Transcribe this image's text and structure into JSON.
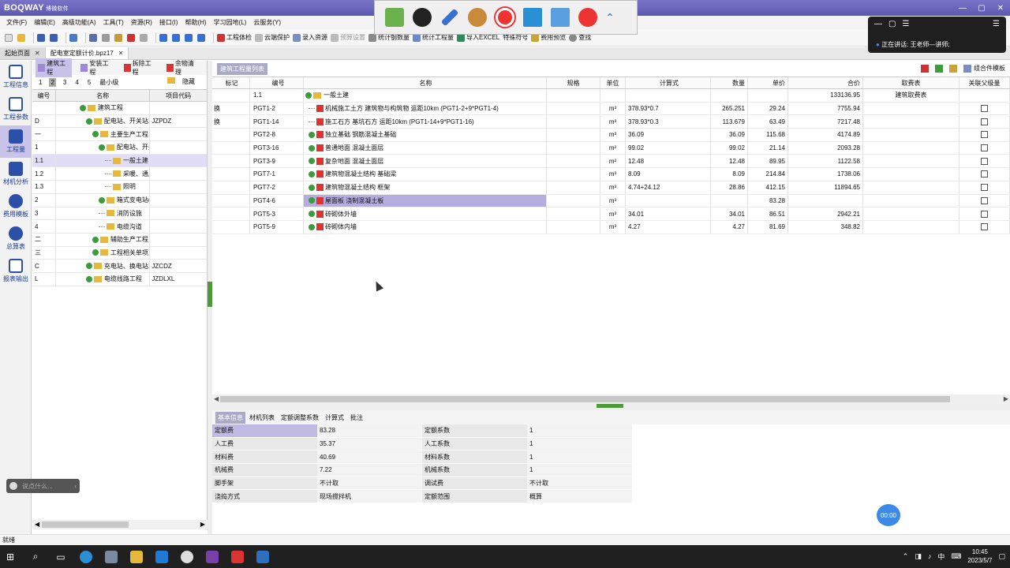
{
  "app": {
    "logo": "BOQWAY",
    "logo_sub": "博微软件"
  },
  "menu": [
    "文件(F)",
    "编辑(E)",
    "高级功能(A)",
    "工具(T)",
    "资源(R)",
    "接口(I)",
    "帮助(H)",
    "学习园地(L)",
    "云服务(Y)"
  ],
  "toolbar": [
    "工程体检",
    "云端保护",
    "录入资源",
    "预算设置",
    "统计钢数量",
    "统计工程量",
    "导入EXCEL",
    "特殊符号",
    "费用预览",
    "查找"
  ],
  "doc_tabs": [
    {
      "label": "起始页面"
    },
    {
      "label": "配电室定额计价.bpz17"
    }
  ],
  "leftbar": [
    "工程信息",
    "工程参数",
    "工程量",
    "材机分析",
    "费用模板",
    "总算表",
    "报表输出"
  ],
  "left_panel": {
    "tabs": [
      "建筑工程",
      "安装工程",
      "拆除工程",
      "余物清理"
    ],
    "levels": [
      "1",
      "2",
      "3",
      "4",
      "5",
      "最小级"
    ],
    "hide": "隐藏",
    "headers": [
      "编号",
      "名称",
      "项目代码"
    ],
    "rows": [
      {
        "code": "",
        "name": "建筑工程",
        "pc": ""
      },
      {
        "code": "D",
        "name": "配电站、开关站工程",
        "pc": "JZPDZ"
      },
      {
        "code": "一",
        "name": "主要生产工程",
        "pc": ""
      },
      {
        "code": "1",
        "name": "配电站、开关站",
        "pc": ""
      },
      {
        "code": "1.1",
        "name": "一般土建",
        "pc": ""
      },
      {
        "code": "1.2",
        "name": "采暖、通风及空调",
        "pc": ""
      },
      {
        "code": "1.3",
        "name": "照明",
        "pc": ""
      },
      {
        "code": "2",
        "name": "箱式变电站(环网箱)",
        "pc": ""
      },
      {
        "code": "3",
        "name": "消防设施",
        "pc": ""
      },
      {
        "code": "4",
        "name": "电缆沟道",
        "pc": ""
      },
      {
        "code": "二",
        "name": "辅助生产工程",
        "pc": ""
      },
      {
        "code": "三",
        "name": "工程相关单项工程",
        "pc": ""
      },
      {
        "code": "C",
        "name": "充电站、换电站工程",
        "pc": "JZCDZ"
      },
      {
        "code": "L",
        "name": "电缆线路工程",
        "pc": "JZDLXL"
      }
    ]
  },
  "grid": {
    "tab": "建筑工程量列表",
    "right_label": "组合件模板",
    "headers": [
      "标记",
      "编号",
      "名称",
      "规格",
      "单位",
      "计算式",
      "数量",
      "单价",
      "合价",
      "取费表",
      "关联父级量"
    ],
    "rows": [
      {
        "mark": "",
        "code": "1.1",
        "name": "一般土建",
        "spec": "",
        "unit": "",
        "formula": "",
        "qty": "",
        "price": "",
        "total": "133136.95",
        "table": "建筑取费表"
      },
      {
        "mark": "换",
        "code": "PGT1-2",
        "name": "机械施工土方 建筑物与构筑物 运距10km (PGT1-2+9*PGT1-4)",
        "spec": "",
        "unit": "m³",
        "formula": "378.93*0.7",
        "qty": "265.251",
        "price": "29.24",
        "total": "7755.94",
        "table": ""
      },
      {
        "mark": "换",
        "code": "PGT1-14",
        "name": "施工石方 基坑石方 运距10km (PGT1-14+9*PGT1-16)",
        "spec": "",
        "unit": "m³",
        "formula": "378.93*0.3",
        "qty": "113.679",
        "price": "63.49",
        "total": "7217.48",
        "table": ""
      },
      {
        "mark": "",
        "code": "PGT2-8",
        "name": "独立基础 钢筋混凝土基础",
        "spec": "",
        "unit": "m³",
        "formula": "36.09",
        "qty": "36.09",
        "price": "115.68",
        "total": "4174.89",
        "table": ""
      },
      {
        "mark": "",
        "code": "PGT3-16",
        "name": "普通地面 混凝土面层",
        "spec": "",
        "unit": "m²",
        "formula": "99.02",
        "qty": "99.02",
        "price": "21.14",
        "total": "2093.28",
        "table": ""
      },
      {
        "mark": "",
        "code": "PGT3-9",
        "name": "复杂地面 混凝土面层",
        "spec": "",
        "unit": "m²",
        "formula": "12.48",
        "qty": "12.48",
        "price": "89.95",
        "total": "1122.58",
        "table": ""
      },
      {
        "mark": "",
        "code": "PGT7-1",
        "name": "建筑物混凝土结构 基础梁",
        "spec": "",
        "unit": "m³",
        "formula": "8.09",
        "qty": "8.09",
        "price": "214.84",
        "total": "1738.06",
        "table": ""
      },
      {
        "mark": "",
        "code": "PGT7-2",
        "name": "建筑物混凝土结构 框架",
        "spec": "",
        "unit": "m³",
        "formula": "4.74+24.12",
        "qty": "28.86",
        "price": "412.15",
        "total": "11894.65",
        "table": ""
      },
      {
        "mark": "",
        "code": "PGT4-6",
        "name": "屋面板 浇制混凝土板",
        "spec": "",
        "unit": "m³",
        "formula": "",
        "qty": "",
        "price": "83.28",
        "total": "",
        "table": ""
      },
      {
        "mark": "",
        "code": "PGT5-3",
        "name": "砖砌体外墙",
        "spec": "",
        "unit": "m³",
        "formula": "34.01",
        "qty": "34.01",
        "price": "86.51",
        "total": "2942.21",
        "table": ""
      },
      {
        "mark": "",
        "code": "PGT5-9",
        "name": "砖砌体内墙",
        "spec": "",
        "unit": "m³",
        "formula": "4.27",
        "qty": "4.27",
        "price": "81.69",
        "total": "348.82",
        "table": ""
      }
    ]
  },
  "bottom": {
    "tabs": [
      "基本信息",
      "材机列表",
      "定额调整系数",
      "计算式",
      "批注"
    ],
    "props": [
      {
        "l": "定额费",
        "v": "83.28",
        "l2": "定额系数",
        "v2": "1"
      },
      {
        "l": "人工费",
        "v": "35.37",
        "l2": "人工系数",
        "v2": "1"
      },
      {
        "l": "材料费",
        "v": "40.69",
        "l2": "材料系数",
        "v2": "1"
      },
      {
        "l": "机械费",
        "v": "7.22",
        "l2": "机械系数",
        "v2": "1"
      },
      {
        "l": "脚手架",
        "v": "不计取",
        "l2": "调试费",
        "v2": "不计取"
      },
      {
        "l": "浇捣方式",
        "v": "现场搅拌机",
        "l2": "定额范围",
        "v2": "概算"
      }
    ]
  },
  "status": "就绪",
  "call": {
    "talk": "正在讲话: 王老师—讲师;"
  },
  "mini_input": "说点什么...",
  "timer": "00:00",
  "tray": {
    "ime": "中",
    "time": "10:45",
    "date": "2023/5/7"
  }
}
